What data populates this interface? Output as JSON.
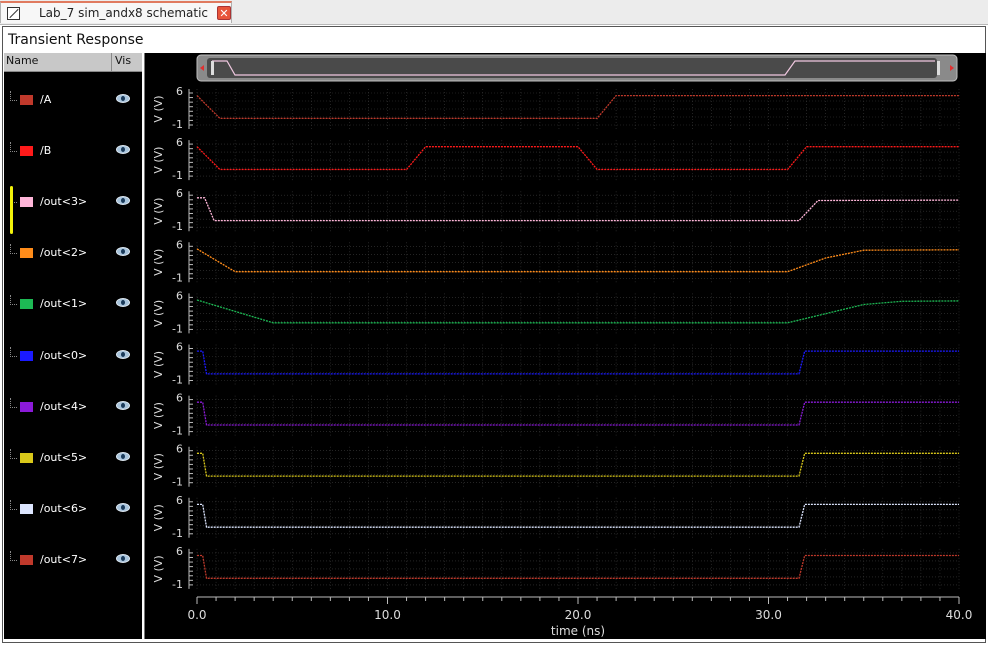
{
  "tab": {
    "title": "Lab_7 sim_andx8 schematic",
    "close_icon": "close-icon"
  },
  "panel": {
    "title": "Transient Response"
  },
  "sidebar": {
    "col_name": "Name",
    "col_vis": "Vis"
  },
  "signals": [
    {
      "name": "/A",
      "color": "#c0392b"
    },
    {
      "name": "/B",
      "color": "#ff1a1a"
    },
    {
      "name": "/out<3>",
      "color": "#ffb6d9"
    },
    {
      "name": "/out<2>",
      "color": "#ff8c1a"
    },
    {
      "name": "/out<1>",
      "color": "#1db954"
    },
    {
      "name": "/out<0>",
      "color": "#1a1aff"
    },
    {
      "name": "/out<4>",
      "color": "#8b1ad9"
    },
    {
      "name": "/out<5>",
      "color": "#d9c81a"
    },
    {
      "name": "/out<6>",
      "color": "#dde6ff"
    },
    {
      "name": "/out<7>",
      "color": "#c0392b"
    }
  ],
  "chart_data": {
    "type": "line",
    "xlabel": "time (ns)",
    "ylabel": "V (V)",
    "xlim": [
      0,
      40
    ],
    "ylim": [
      -1,
      6
    ],
    "x_ticks": [
      "0.0",
      "10.0",
      "20.0",
      "30.0",
      "40.0"
    ],
    "y_ticks": [
      "6",
      "-1"
    ],
    "series": [
      {
        "name": "/A",
        "points": [
          [
            0,
            5
          ],
          [
            1.2,
            0
          ],
          [
            21,
            0
          ],
          [
            22,
            5
          ],
          [
            40,
            5
          ]
        ]
      },
      {
        "name": "/B",
        "points": [
          [
            0,
            5
          ],
          [
            1.2,
            0
          ],
          [
            11,
            0
          ],
          [
            12,
            5
          ],
          [
            20,
            5
          ],
          [
            21,
            0
          ],
          [
            31,
            0
          ],
          [
            32,
            5
          ],
          [
            40,
            5
          ]
        ]
      },
      {
        "name": "/out<3>",
        "points": [
          [
            0,
            5
          ],
          [
            0.4,
            5
          ],
          [
            0.9,
            0
          ],
          [
            31.6,
            0
          ],
          [
            32.6,
            4.4
          ],
          [
            40,
            4.5
          ]
        ]
      },
      {
        "name": "/out<2>",
        "points": [
          [
            0,
            5
          ],
          [
            1,
            2.5
          ],
          [
            2,
            0
          ],
          [
            31,
            0
          ],
          [
            33,
            3
          ],
          [
            35,
            4.7
          ],
          [
            40,
            4.8
          ]
        ]
      },
      {
        "name": "/out<1>",
        "points": [
          [
            0,
            5
          ],
          [
            2,
            2.5
          ],
          [
            4,
            0
          ],
          [
            31,
            0
          ],
          [
            33,
            2
          ],
          [
            35,
            4
          ],
          [
            37,
            4.7
          ],
          [
            40,
            4.8
          ]
        ]
      },
      {
        "name": "/out<0>",
        "points": [
          [
            0,
            5
          ],
          [
            0.3,
            5
          ],
          [
            0.5,
            0
          ],
          [
            31.6,
            0
          ],
          [
            31.9,
            5
          ],
          [
            40,
            5
          ]
        ]
      },
      {
        "name": "/out<4>",
        "points": [
          [
            0,
            5
          ],
          [
            0.3,
            5
          ],
          [
            0.5,
            0
          ],
          [
            31.6,
            0
          ],
          [
            31.9,
            5
          ],
          [
            40,
            5
          ]
        ]
      },
      {
        "name": "/out<5>",
        "points": [
          [
            0,
            5
          ],
          [
            0.3,
            5
          ],
          [
            0.5,
            0
          ],
          [
            31.6,
            0
          ],
          [
            31.9,
            5
          ],
          [
            40,
            5
          ]
        ]
      },
      {
        "name": "/out<6>",
        "points": [
          [
            0,
            5
          ],
          [
            0.3,
            5
          ],
          [
            0.5,
            0
          ],
          [
            31.6,
            0
          ],
          [
            31.9,
            5
          ],
          [
            40,
            5
          ]
        ]
      },
      {
        "name": "/out<7>",
        "points": [
          [
            0,
            5
          ],
          [
            0.3,
            5
          ],
          [
            0.5,
            0
          ],
          [
            31.6,
            0
          ],
          [
            31.9,
            5
          ],
          [
            40,
            5
          ]
        ]
      }
    ]
  }
}
